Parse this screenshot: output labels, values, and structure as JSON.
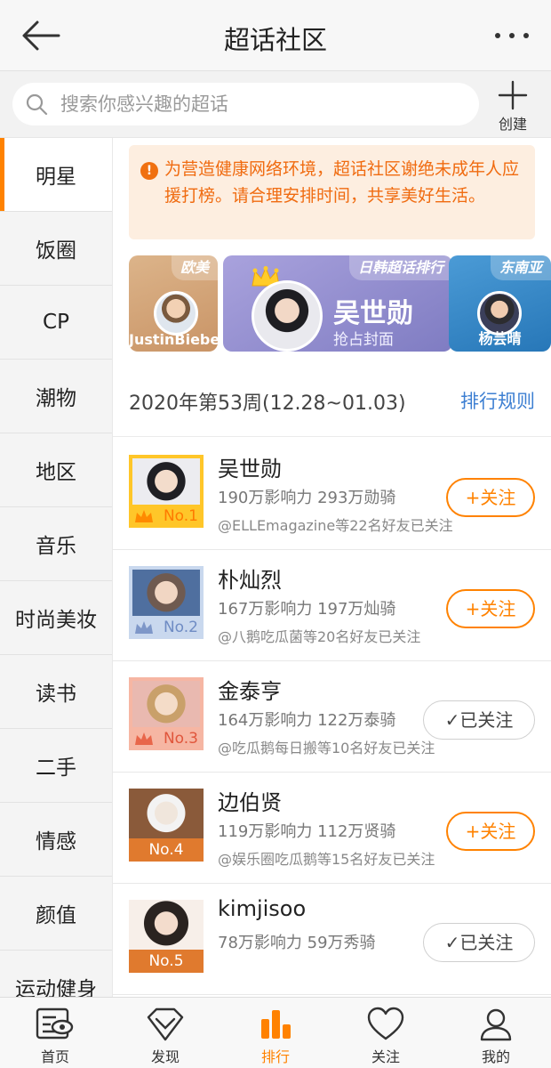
{
  "header": {
    "title": "超话社区",
    "back_icon": "arrow-left-icon",
    "more_icon": "more-dots-icon"
  },
  "search": {
    "placeholder": "搜索你感兴趣的超话",
    "create_label": "创建"
  },
  "sidebar": {
    "items": [
      {
        "label": "明星",
        "active": true
      },
      {
        "label": "饭圈"
      },
      {
        "label": "CP"
      },
      {
        "label": "潮物"
      },
      {
        "label": "地区"
      },
      {
        "label": "音乐"
      },
      {
        "label": "时尚美妆"
      },
      {
        "label": "读书"
      },
      {
        "label": "二手"
      },
      {
        "label": "情感"
      },
      {
        "label": "颜值"
      },
      {
        "label": "运动健身"
      }
    ]
  },
  "notice": {
    "text": "为营造健康网络环境，超话社区谢绝未成年人应援打榜。请合理安排时间，共享美好生活。",
    "icon": "!"
  },
  "carousel": {
    "left": {
      "tag": "欧美",
      "name": "JustinBieber"
    },
    "center": {
      "tag": "日韩超话排行",
      "name": "吴世勋",
      "sub": "抢占封面"
    },
    "right": {
      "tag": "东南亚",
      "name": "杨芸晴"
    }
  },
  "week": {
    "text": "2020年第53周(12.28~01.03)",
    "rules": "排行规则"
  },
  "ranks": [
    {
      "badge": "No.1",
      "name": "吴世勋",
      "stats": "190万影响力 293万勋骑",
      "friends": "@ELLEmagazine等22名好友已关注",
      "button": "+关注",
      "followed": false
    },
    {
      "badge": "No.2",
      "name": "朴灿烈",
      "stats": "167万影响力 197万灿骑",
      "friends": "@八鹅吃瓜菌等20名好友已关注",
      "button": "+关注",
      "followed": false
    },
    {
      "badge": "No.3",
      "name": "金泰亨",
      "stats": "164万影响力 122万泰骑",
      "friends": "@吃瓜鹅每日搬等10名好友已关注",
      "button": "✓已关注",
      "followed": true
    },
    {
      "badge": "No.4",
      "name": "边伯贤",
      "stats": "119万影响力 112万贤骑",
      "friends": "@娱乐圈吃瓜鹅等15名好友已关注",
      "button": "+关注",
      "followed": false
    },
    {
      "badge": "No.5",
      "name": "kimjisoo",
      "stats": "78万影响力 59万秀骑",
      "friends": "",
      "button": "✓已关注",
      "followed": true
    }
  ],
  "tabbar": {
    "items": [
      {
        "label": "首页",
        "icon": "home-eye-icon"
      },
      {
        "label": "发现",
        "icon": "diamond-icon"
      },
      {
        "label": "排行",
        "icon": "ranking-bars-icon",
        "active": true
      },
      {
        "label": "关注",
        "icon": "heart-icon"
      },
      {
        "label": "我的",
        "icon": "person-icon"
      }
    ]
  },
  "colors": {
    "accent": "#ff8200",
    "link": "#3d7fd2",
    "notice_bg": "#fdeee0",
    "notice_text": "#f06b10"
  }
}
